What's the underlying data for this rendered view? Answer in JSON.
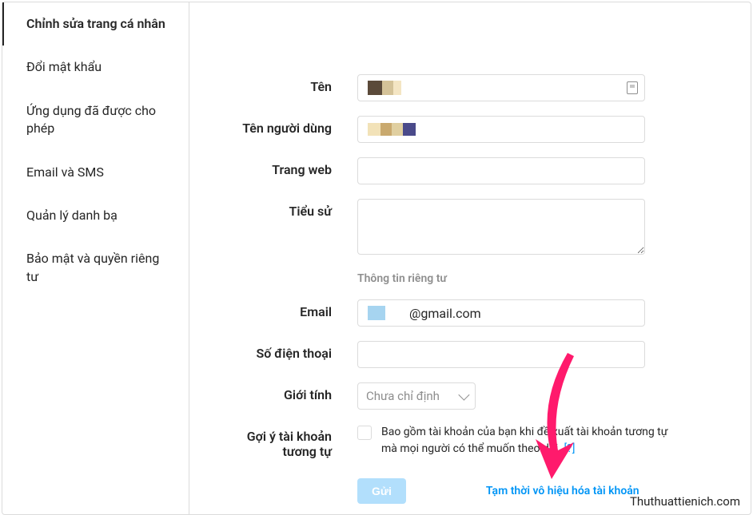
{
  "sidebar": {
    "items": [
      {
        "label": "Chỉnh sửa trang cá nhân",
        "active": true
      },
      {
        "label": "Đổi mật khẩu",
        "active": false
      },
      {
        "label": "Ứng dụng đã được cho phép",
        "active": false
      },
      {
        "label": "Email và SMS",
        "active": false
      },
      {
        "label": "Quản lý danh bạ",
        "active": false
      },
      {
        "label": "Bảo mật và quyền riêng tư",
        "active": false
      }
    ]
  },
  "form": {
    "name_label": "Tên",
    "username_label": "Tên người dùng",
    "website_label": "Trang web",
    "bio_label": "Tiểu sử",
    "private_section": "Thông tin riêng tư",
    "email_label": "Email",
    "email_domain": "@gmail.com",
    "phone_label": "Số điện thoại",
    "gender_label": "Giới tính",
    "gender_value": "Chưa chỉ định",
    "similar_label": "Gợi ý tài khoản tương tự",
    "similar_desc": "Bao gồm tài khoản của bạn khi đề xuất tài khoản tương tự mà mọi người có thể muốn theo dõi.",
    "similar_help": "[?]",
    "submit_label": "Gửi",
    "disable_link": "Tạm thời vô hiệu hóa tài khoản"
  },
  "watermark": "Thuthuattienich.com"
}
